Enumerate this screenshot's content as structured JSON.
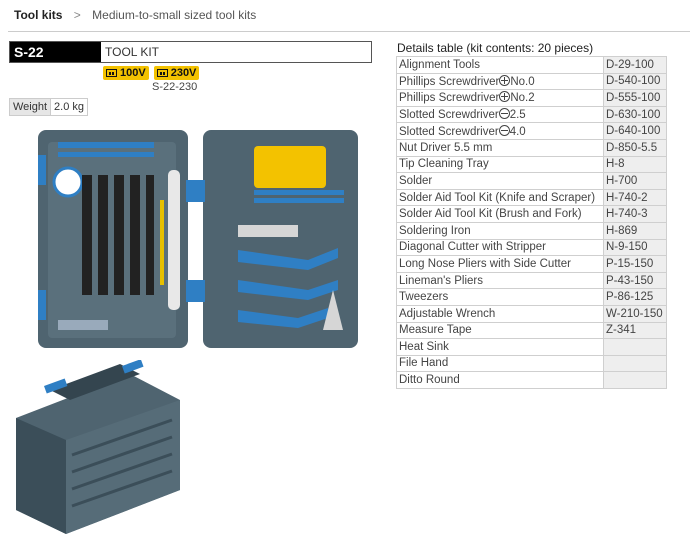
{
  "breadcrumb": {
    "home": "Tool kits",
    "separator": ">",
    "current": "Medium-to-small sized tool kits"
  },
  "product": {
    "code": "S-22",
    "name": "TOOL KIT",
    "voltages": [
      "100V",
      "230V"
    ],
    "sub_code": "S-22-230",
    "weight_label": "Weight",
    "weight_value": "2.0 kg"
  },
  "details": {
    "title": "Details table (kit contents: 20 pieces)",
    "rows": [
      {
        "name": "Alignment Tools",
        "code": "D-29-100"
      },
      {
        "name": "Phillips Screwdriver",
        "symbol": "plus",
        "suffix": "No.0",
        "code": "D-540-100"
      },
      {
        "name": "Phillips Screwdriver",
        "symbol": "plus",
        "suffix": "No.2",
        "code": " D-555-100"
      },
      {
        "name": "Slotted Screwdriver",
        "symbol": "minus",
        "suffix": "2.5",
        "code": "D-630-100"
      },
      {
        "name": "Slotted Screwdriver",
        "symbol": "minus",
        "suffix": "4.0",
        "code": "D-640-100"
      },
      {
        "name": "Nut Driver 5.5 mm",
        "code": "D-850-5.5"
      },
      {
        "name": "Tip Cleaning Tray",
        "code": "H-8"
      },
      {
        "name": "Solder",
        "code": "H-700"
      },
      {
        "name": "Solder Aid Tool Kit (Knife and Scraper)",
        "code": "H-740-2"
      },
      {
        "name": "Solder Aid Tool Kit (Brush and Fork)",
        "code": "H-740-3"
      },
      {
        "name": "Soldering Iron",
        "code": "H-869"
      },
      {
        "name": "Diagonal Cutter with Stripper",
        "code": "N-9-150"
      },
      {
        "name": "Long Nose Pliers with Side Cutter",
        "code": "P-15-150"
      },
      {
        "name": "Lineman's Pliers",
        "code": "P-43-150"
      },
      {
        "name": "Tweezers",
        "code": "P-86-125"
      },
      {
        "name": "Adjustable Wrench",
        "code": "W-210-150"
      },
      {
        "name": "Measure Tape",
        "code": "Z-341"
      },
      {
        "name": "Heat Sink",
        "code": ""
      },
      {
        "name": "File Hand",
        "code": ""
      },
      {
        "name": "Ditto Round",
        "code": ""
      }
    ]
  },
  "colors": {
    "case": "#4f6470",
    "case_dark": "#34454f",
    "accent_blue": "#2f7fc4",
    "badge": "#f3c200"
  },
  "images": {
    "open_case": "tool-kit-open-case-photo",
    "closed_case": "tool-kit-closed-case-photo"
  }
}
